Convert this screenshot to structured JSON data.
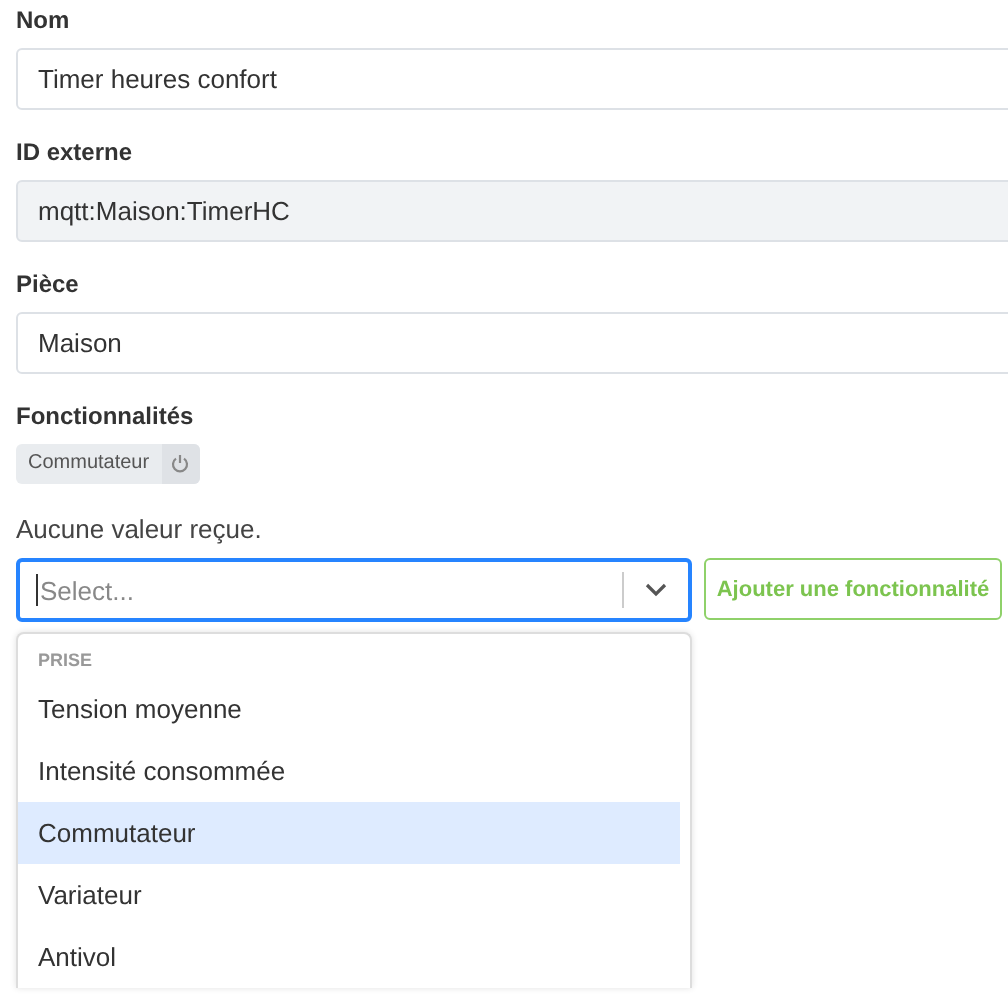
{
  "fields": [
    {
      "label": "Nom",
      "value": "Timer heures confort",
      "readonly": false
    },
    {
      "label": "ID externe",
      "value": "mqtt:Maison:TimerHC",
      "readonly": true
    },
    {
      "label": "Pièce",
      "value": "Maison",
      "readonly": false
    }
  ],
  "features": {
    "label": "Fonctionnalités",
    "chips": [
      {
        "label": "Commutateur"
      }
    ],
    "status": "Aucune valeur reçue."
  },
  "select": {
    "placeholder": "Select...",
    "focused": true
  },
  "add_button": "Ajouter une fonctionnalité",
  "dropdown": {
    "group": "PRISE",
    "options": [
      {
        "label": "Tension moyenne",
        "selected": false
      },
      {
        "label": "Intensité consommée",
        "selected": false
      },
      {
        "label": "Commutateur",
        "selected": true
      },
      {
        "label": "Variateur",
        "selected": false
      },
      {
        "label": "Antivol",
        "selected": false
      }
    ]
  }
}
